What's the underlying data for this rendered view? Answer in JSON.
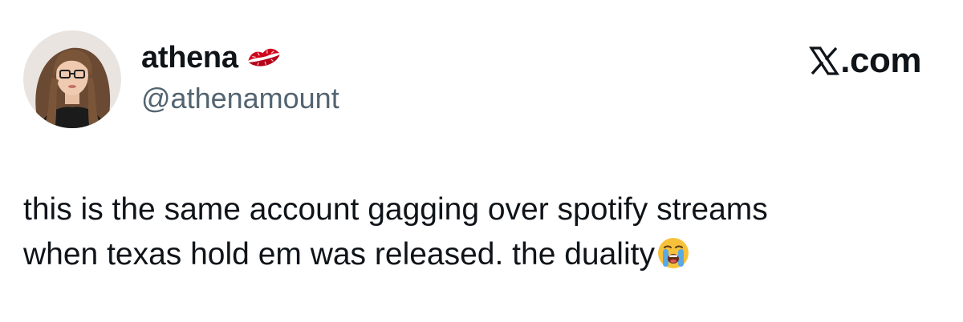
{
  "author": {
    "display_name": "athena",
    "handle": "@athenamount",
    "name_emoji": "kiss-mark-icon",
    "avatar": "profile-photo"
  },
  "site": {
    "domain": ".com",
    "logo": "x-logo-icon"
  },
  "tweet": {
    "line1": "this is the same account gagging over spotify streams",
    "line2": "when texas hold em was released. the duality",
    "trailing_emoji": "loudly-crying-face-icon"
  },
  "colors": {
    "text": "#0f1419",
    "secondary_text": "#536471",
    "background": "#ffffff",
    "kiss": "#d0021b",
    "emoji_yellow": "#f7c23a",
    "tears": "#5aa9e6"
  }
}
